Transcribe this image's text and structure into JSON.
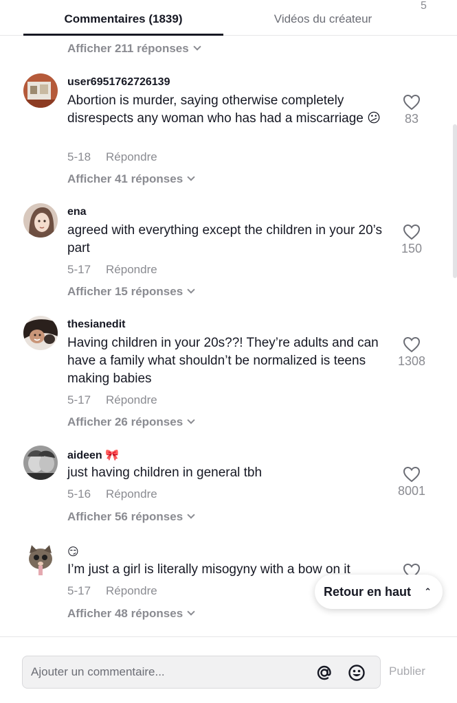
{
  "tabs": {
    "comments": "Commentaires (1839)",
    "videos": "Vidéos du créateur",
    "corner": "5"
  },
  "top_replies": "Afficher 211 réponses",
  "comments": [
    {
      "username": "user6951762726139",
      "text": "Abortion is murder, saying otherwise completely disrespects any woman who has had a miscarriage 😕",
      "date": "5-18",
      "reply": "Répondre",
      "likes": "83",
      "replies": "Afficher 41 réponses"
    },
    {
      "username": "ena",
      "text": "agreed with everything except the children in your 20’s part",
      "date": "5-17",
      "reply": "Répondre",
      "likes": "150",
      "replies": "Afficher 15 réponses"
    },
    {
      "username": "thesianedit",
      "text": "Having children in your 20s??! They’re adults and can have a family what shouldn’t be normalized is teens making babies",
      "date": "5-17",
      "reply": "Répondre",
      "likes": "1308",
      "replies": "Afficher 26 réponses"
    },
    {
      "username": "aideen 🎀",
      "text": "just having children in general tbh",
      "date": "5-16",
      "reply": "Répondre",
      "likes": "8001",
      "replies": "Afficher 56 réponses"
    },
    {
      "username": "😏",
      "text": "I’m just a girl is literally misogyny with a bow on it",
      "date": "5-17",
      "reply": "Répondre",
      "likes": "",
      "replies": "Afficher 48 réponses"
    }
  ],
  "back_to_top": "Retour en haut",
  "footer": {
    "placeholder": "Ajouter un commentaire...",
    "publish": "Publier"
  }
}
